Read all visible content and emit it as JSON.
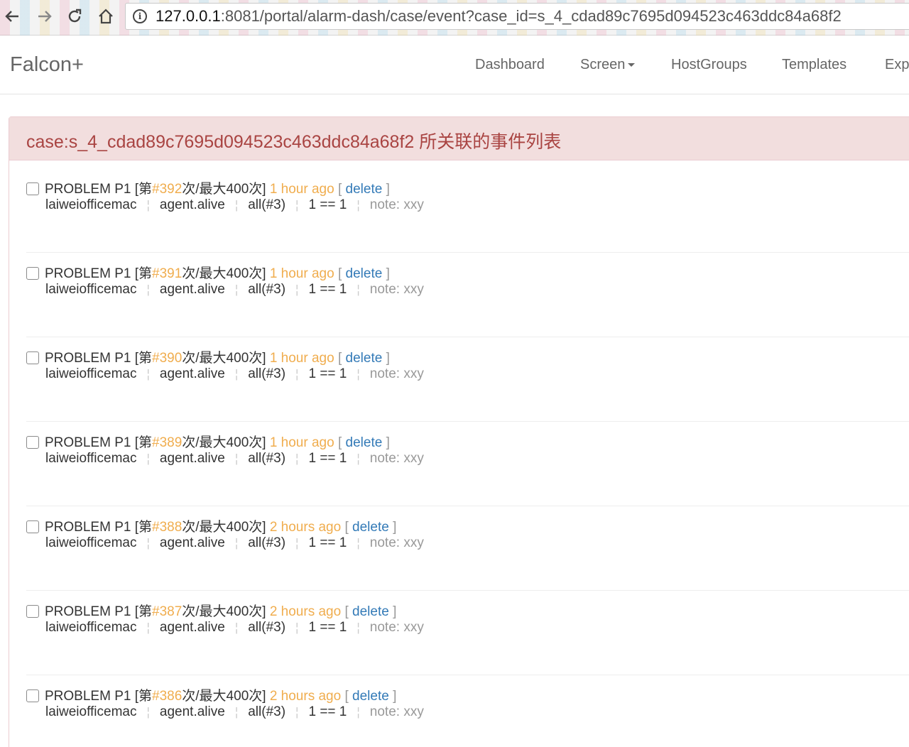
{
  "browser": {
    "url_host": "127.0.0.1",
    "url_rest": ":8081/portal/alarm-dash/case/event?case_id=s_4_cdad89c7695d094523c463ddc84a68f2"
  },
  "navbar": {
    "brand": "Falcon+",
    "links": [
      "Dashboard",
      "Screen",
      "HostGroups",
      "Templates",
      "Exp"
    ]
  },
  "panel": {
    "title": "case:s_4_cdad89c7695d094523c463ddc84a68f2 所关联的事件列表"
  },
  "events": [
    {
      "status": "PROBLEM P1",
      "prefix": "[第",
      "step": "#392",
      "suffix": "次/最大400次]",
      "time": "1 hour ago",
      "action": "delete",
      "host": "laiweiofficemac",
      "metric": "agent.alive",
      "func": "all(#3)",
      "condition": "1 == 1",
      "note": "note: xxy"
    },
    {
      "status": "PROBLEM P1",
      "prefix": "[第",
      "step": "#391",
      "suffix": "次/最大400次]",
      "time": "1 hour ago",
      "action": "delete",
      "host": "laiweiofficemac",
      "metric": "agent.alive",
      "func": "all(#3)",
      "condition": "1 == 1",
      "note": "note: xxy"
    },
    {
      "status": "PROBLEM P1",
      "prefix": "[第",
      "step": "#390",
      "suffix": "次/最大400次]",
      "time": "1 hour ago",
      "action": "delete",
      "host": "laiweiofficemac",
      "metric": "agent.alive",
      "func": "all(#3)",
      "condition": "1 == 1",
      "note": "note: xxy"
    },
    {
      "status": "PROBLEM P1",
      "prefix": "[第",
      "step": "#389",
      "suffix": "次/最大400次]",
      "time": "1 hour ago",
      "action": "delete",
      "host": "laiweiofficemac",
      "metric": "agent.alive",
      "func": "all(#3)",
      "condition": "1 == 1",
      "note": "note: xxy"
    },
    {
      "status": "PROBLEM P1",
      "prefix": "[第",
      "step": "#388",
      "suffix": "次/最大400次]",
      "time": "2 hours ago",
      "action": "delete",
      "host": "laiweiofficemac",
      "metric": "agent.alive",
      "func": "all(#3)",
      "condition": "1 == 1",
      "note": "note: xxy"
    },
    {
      "status": "PROBLEM P1",
      "prefix": "[第",
      "step": "#387",
      "suffix": "次/最大400次]",
      "time": "2 hours ago",
      "action": "delete",
      "host": "laiweiofficemac",
      "metric": "agent.alive",
      "func": "all(#3)",
      "condition": "1 == 1",
      "note": "note: xxy"
    },
    {
      "status": "PROBLEM P1",
      "prefix": "[第",
      "step": "#386",
      "suffix": "次/最大400次]",
      "time": "2 hours ago",
      "action": "delete",
      "host": "laiweiofficemac",
      "metric": "agent.alive",
      "func": "all(#3)",
      "condition": "1 == 1",
      "note": "note: xxy"
    }
  ],
  "colors": {
    "heading_bg": "#f2dede",
    "heading_text": "#a94442",
    "orange": "#f0ad4e",
    "link": "#337ab7"
  }
}
